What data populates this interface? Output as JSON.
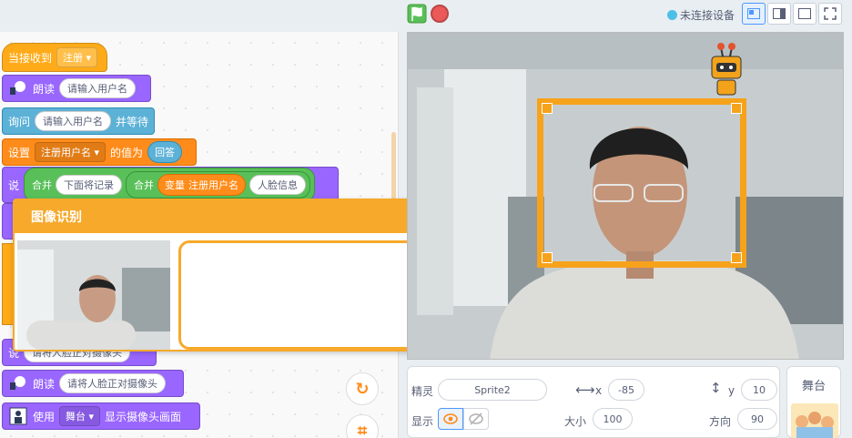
{
  "toolbar": {
    "connection_status": "未连接设备"
  },
  "blocks": {
    "hat": {
      "label": "当接收到",
      "dropdown": "注册"
    },
    "read1": {
      "label": "朗读",
      "text": "请输入用户名"
    },
    "ask": {
      "label": "询问",
      "text": "请输入用户名",
      "suffix": "并等待"
    },
    "set": {
      "label": "设置",
      "dropdown": "注册用户名",
      "mid": "的值为",
      "reporter": "回答"
    },
    "say": {
      "label": "说",
      "join1": "合并",
      "text1": "下面将记录",
      "join2": "合并",
      "var_label": "变量",
      "var_name": "注册用户名",
      "text2": "人脸信息"
    },
    "say2": {
      "label": "说",
      "text": "请将人脸正对摄像头"
    },
    "read2": {
      "label": "朗读",
      "text": "请将人脸正对摄像头"
    },
    "use": {
      "label": "使用",
      "dropdown": "舞台",
      "suffix": "显示摄像头画面"
    }
  },
  "dialog": {
    "title": "图像识别"
  },
  "sprite": {
    "label_sprite": "精灵",
    "name": "Sprite2",
    "x_label": "x",
    "x": "-85",
    "y_label": "y",
    "y": "10",
    "show_label": "显示",
    "size_label": "大小",
    "size": "100",
    "dir_label": "方向",
    "direction": "90"
  },
  "stage_panel": {
    "label": "舞台"
  }
}
